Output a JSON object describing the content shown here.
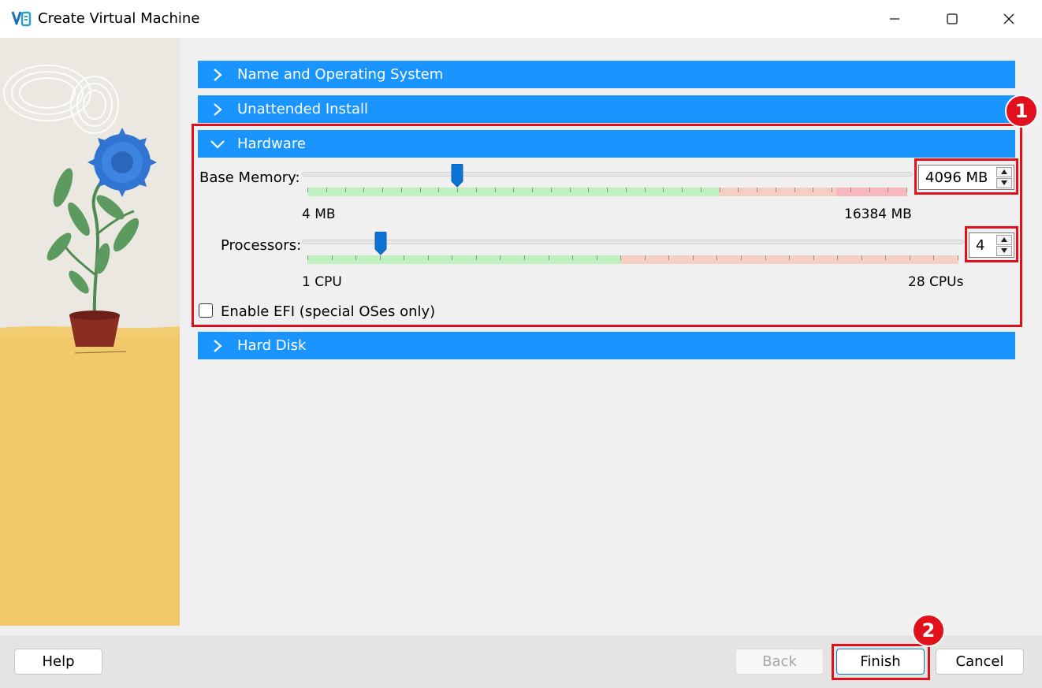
{
  "window": {
    "title": "Create Virtual Machine",
    "controls": [
      "minimize-icon",
      "maximize-icon",
      "close-icon"
    ]
  },
  "sections": {
    "name_os": {
      "label": "Name and Operating System",
      "expanded": false
    },
    "unattended": {
      "label": "Unattended Install",
      "expanded": false
    },
    "hardware": {
      "label": "Hardware",
      "expanded": true
    },
    "hard_disk": {
      "label": "Hard Disk",
      "expanded": false
    }
  },
  "hardware": {
    "memory": {
      "label": "Base Memory:",
      "value": "4096 MB",
      "slider_value_mb": 4096,
      "min_label": "4 MB",
      "max_label": "16384 MB"
    },
    "processors": {
      "label": "Processors:",
      "value": "4",
      "slider_value": 4,
      "min_label": "1 CPU",
      "max_label": "28 CPUs"
    },
    "efi": {
      "label": "Enable EFI (special OSes only)",
      "checked": false
    }
  },
  "annotations": {
    "badge1": "1",
    "badge2": "2"
  },
  "buttons": {
    "help": "Help",
    "back": "Back",
    "finish": "Finish",
    "cancel": "Cancel"
  },
  "colors": {
    "section_header": "#1a94ff",
    "slider_thumb": "#0b72d6",
    "zone_ok": "#bff0c0",
    "zone_warn": "#f5cfc3",
    "zone_bad": "#f6b7bd",
    "annotation": "#e0101c"
  }
}
